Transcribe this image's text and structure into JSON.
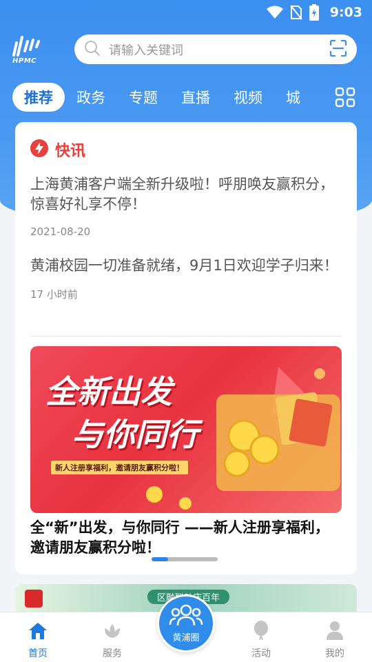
{
  "status_bar": {
    "time": "9:03"
  },
  "app": {
    "logo_text": "HPMC"
  },
  "search": {
    "placeholder": "请输入关键词"
  },
  "tabs": [
    {
      "label": "推荐",
      "active": true
    },
    {
      "label": "政务"
    },
    {
      "label": "专题"
    },
    {
      "label": "直播"
    },
    {
      "label": "视频"
    },
    {
      "label": "城"
    }
  ],
  "flash": {
    "title": "快讯",
    "items": [
      {
        "title": "上海黄浦客户端全新升级啦！呼朋唤友赢积分，惊喜好礼享不停！",
        "date": "2021-08-20"
      },
      {
        "title": "黄浦校园一切准备就绪，9月1日欢迎学子归来！",
        "date": "17 小时前"
      }
    ]
  },
  "banner": {
    "headline_1": "全新出发",
    "headline_2": "与你同行",
    "subline": "新人注册享福利，邀请朋友赢积分啦！",
    "caption": "全“新”出发，与你同行 ——新人注册享福利，邀请朋友赢积分啦！",
    "page_index": 1,
    "page_count": 4
  },
  "banner2": {
    "tag": "区融联动庆百年"
  },
  "bottom_nav": {
    "home": "首页",
    "service": "服务",
    "center": "黄浦圈",
    "activity": "活动",
    "mine": "我的"
  },
  "colors": {
    "primary": "#2f8ceb",
    "flash_red": "#e8403c",
    "header_blue": "#3b8ff0"
  }
}
